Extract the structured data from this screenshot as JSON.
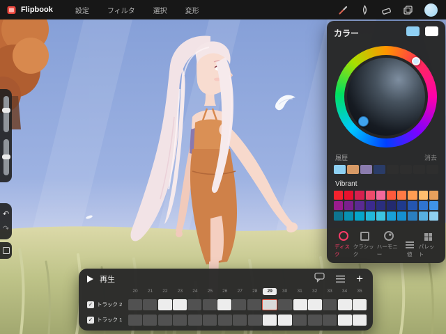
{
  "topbar": {
    "app_title": "Flipbook",
    "menus": [
      "設定",
      "フィルタ",
      "選択",
      "変形"
    ],
    "current_color": "#9ed5f2"
  },
  "sidebar": {
    "undo_glyph": "↶",
    "redo_glyph": "↷"
  },
  "color_panel": {
    "title": "カラー",
    "primary_color": "#8fd0f4",
    "secondary_color": "#ffffff",
    "history_label": "履歴",
    "clear_label": "消去",
    "history_colors": [
      "#8ed0f2",
      "#d79a66",
      "#8b7cae",
      "#2a3c68",
      "#2e2e2e",
      "#2e2e2e",
      "#2e2e2e",
      "#2e2e2e"
    ],
    "palette_label": "Vibrant",
    "palette": [
      [
        "#f5222d",
        "#e8112d",
        "#d6204e",
        "#ef4b6b",
        "#f2699c",
        "#ff5a3c",
        "#ff7a45",
        "#ff9d52",
        "#ffbe6e",
        "#e8a05c"
      ],
      [
        "#9b1b8e",
        "#7a1f8e",
        "#5a2a92",
        "#3b2a8e",
        "#2a2e7e",
        "#232a6e",
        "#1f3a8c",
        "#2456b0",
        "#2f74d0",
        "#3f93e8"
      ],
      [
        "#0e7490",
        "#0891b2",
        "#06a6c9",
        "#22b8d8",
        "#3cc5e0",
        "#19a0d8",
        "#1590d0",
        "#2a7fc0",
        "#57b0e0",
        "#8fd0f0"
      ]
    ],
    "active_tab_color": "#ff3b68",
    "tabs": [
      {
        "label": "ディスク",
        "icon": "disc-icon",
        "active": true
      },
      {
        "label": "クラシック",
        "icon": "classic-icon",
        "active": false
      },
      {
        "label": "ハーモニー",
        "icon": "harmony-icon",
        "active": false
      },
      {
        "label": "値",
        "icon": "value-icon",
        "active": false
      },
      {
        "label": "パレット",
        "icon": "palette-icon",
        "active": false
      }
    ]
  },
  "timeline": {
    "play_label": "再生",
    "add_label": "+",
    "checkbox_glyph": "✓",
    "frames": [
      "20",
      "21",
      "22",
      "23",
      "24",
      "25",
      "26",
      "27",
      "28",
      "29",
      "30",
      "31",
      "32",
      "33",
      "34",
      "35"
    ],
    "current_frame": "29",
    "tracks": [
      {
        "label": "トラック 2",
        "checked": true,
        "cells": [
          "empty",
          "empty",
          "filled",
          "filled",
          "empty",
          "empty",
          "filled",
          "empty",
          "empty",
          "current",
          "empty",
          "filled",
          "filled",
          "empty",
          "filled",
          "filled"
        ]
      },
      {
        "label": "トラック 1",
        "checked": true,
        "cells": [
          "empty",
          "empty",
          "empty",
          "empty",
          "empty",
          "empty",
          "empty",
          "empty",
          "empty",
          "filled",
          "filled",
          "empty",
          "empty",
          "empty",
          "filled",
          "filled"
        ]
      }
    ]
  }
}
